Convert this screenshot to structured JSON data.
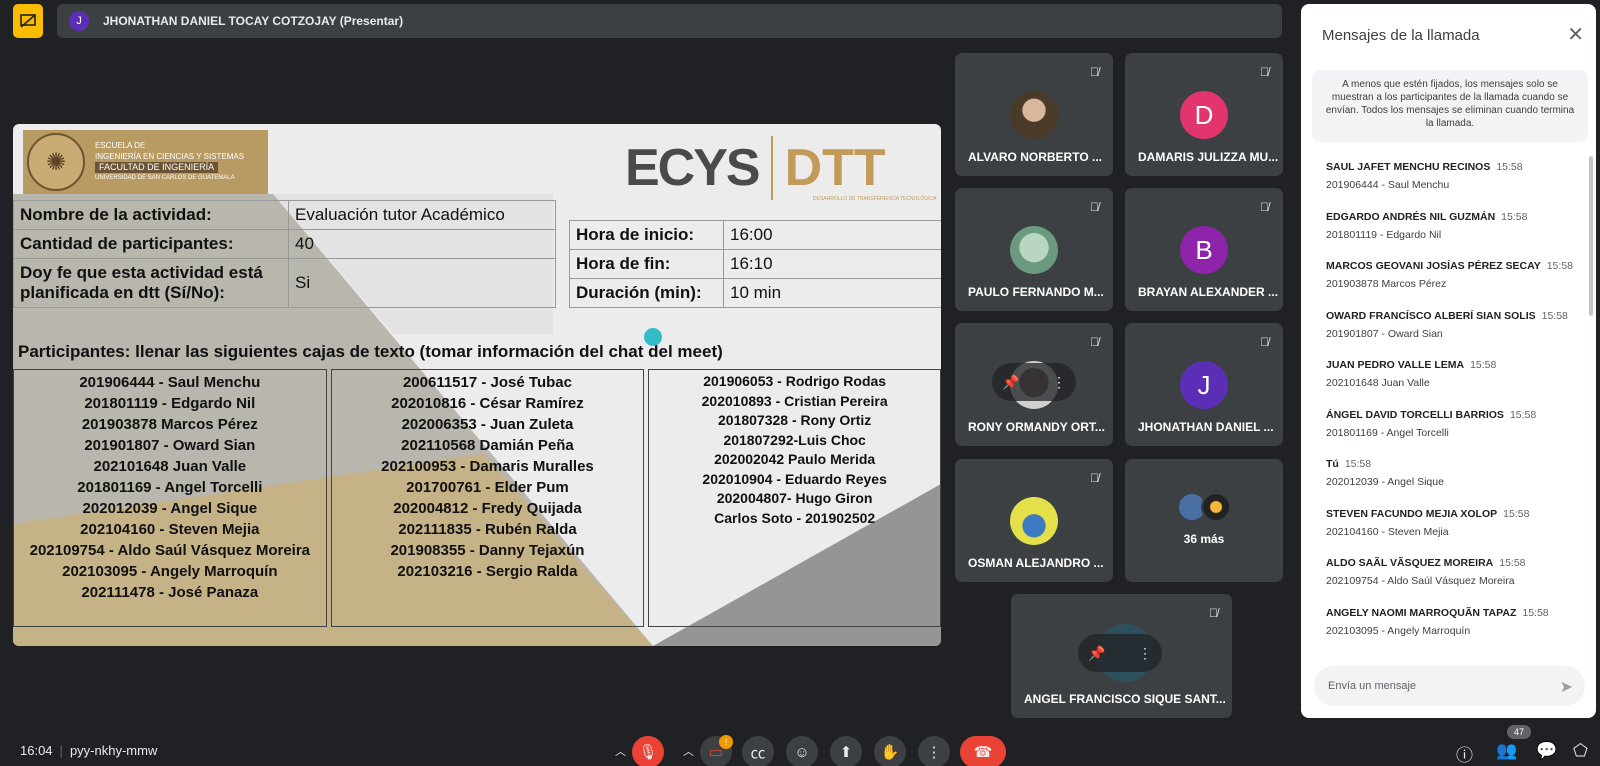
{
  "presenter": {
    "avatar_letter": "J",
    "name": "JHONATHAN DANIEL TOCAY COTZOJAY (Presentar)"
  },
  "slide": {
    "logo": {
      "line1": "ESCUELA DE",
      "line2": "INGENIERÍA EN CIENCIAS Y SISTEMAS",
      "faculty": "FACULTAD DE INGENIERÍA",
      "university": "UNIVERSIDAD DE SAN CARLOS DE GUATEMALA"
    },
    "brand_left": "ECYS",
    "brand_right": "DTT",
    "brand_sub": "DESARROLLO DE TRANSFERENCIA TECNOLÓGICA",
    "left_table": [
      {
        "label": "Nombre de la actividad:",
        "value": "Evaluación tutor Académico"
      },
      {
        "label": "Cantidad de participantes:",
        "value": "40"
      },
      {
        "label": "Doy fe que esta actividad está planificada en dtt (Sí/No):",
        "value": "Si"
      }
    ],
    "right_table": [
      {
        "label": "Hora de inicio:",
        "value": "16:00"
      },
      {
        "label": "Hora de fin:",
        "value": "16:10"
      },
      {
        "label": "Duración (min):",
        "value": "10 min"
      }
    ],
    "instruction": "Participantes: llenar las siguientes cajas de texto (tomar información del chat del meet)",
    "col1": [
      "201906444 - Saul Menchu",
      "201801119 - Edgardo Nil",
      "201903878 Marcos Pérez",
      "201901807 - Oward Sian",
      "202101648 Juan Valle",
      "201801169 - Angel Torcelli",
      "202012039 - Angel Sique",
      "202104160 - Steven Mejia",
      "202109754 - Aldo Saúl Vásquez Moreira",
      "202103095 - Angely Marroquín",
      "202111478 - José Panaza"
    ],
    "col2": [
      "200611517 - José Tubac",
      "202010816 - César Ramírez",
      "202006353 - Juan Zuleta",
      "202110568 Damián Peña",
      "202100953 - Damaris Muralles",
      "201700761 - Elder Pum",
      "202004812 - Fredy Quijada",
      "202111835 - Rubén Ralda",
      "201908355 - Danny Tejaxún",
      "202103216 - Sergio Ralda"
    ],
    "col3": [
      "201906053 - Rodrigo Rodas",
      "202010893 - Cristian Pereira",
      "201807328 - Rony Ortiz",
      "201807292-Luis Choc",
      "202002042 Paulo Merida",
      "202010904 - Eduardo Reyes",
      "202004807- Hugo Giron",
      "Carlos Soto - 201902502"
    ]
  },
  "tiles": [
    {
      "name": "ALVARO NORBERTO ...",
      "avatar": "",
      "photo": "ph"
    },
    {
      "name": "DAMARIS JULIZZA MU...",
      "avatar": "D",
      "color": "#e2356e"
    },
    {
      "name": "PAULO FERNANDO M...",
      "avatar": "",
      "photo": "ph2"
    },
    {
      "name": "BRAYAN ALEXANDER ...",
      "avatar": "B",
      "color": "#8e24aa"
    },
    {
      "name": "RONY ORMANDY ORT...",
      "avatar": "",
      "photo": "ph3"
    },
    {
      "name": "JHONATHAN DANIEL ...",
      "avatar": "J",
      "color": "#5b2fb5"
    },
    {
      "name": "OSMAN ALEJANDRO ...",
      "avatar": "",
      "photo": "ph4"
    },
    {
      "name": "36 más",
      "avatar": ""
    },
    {
      "name": "ANGEL FRANCISCO SIQUE SANT..."
    }
  ],
  "chat": {
    "title": "Mensajes de la llamada",
    "note": "A menos que estén fijados, los mensajes solo se muestran a los participantes de la llamada cuando se envían. Todos los mensajes se eliminan cuando termina la llamada.",
    "messages": [
      {
        "who": "SAUL JAFET MENCHU RECINOS",
        "time": "15:58",
        "text": "201906444 - Saul Menchu"
      },
      {
        "who": "EDGARDO ANDRÉS NIL GUZMÁN",
        "time": "15:58",
        "text": "201801119 - Edgardo Nil"
      },
      {
        "who": "MARCOS GEOVANI JOSÍAS PÉREZ SECAY",
        "time": "15:58",
        "text": "201903878 Marcos Pérez"
      },
      {
        "who": "OWARD FRANCÍSCO ALBERÍ SIAN SOLIS",
        "time": "15:58",
        "text": "201901807 - Oward Sian"
      },
      {
        "who": "JUAN PEDRO VALLE LEMA",
        "time": "15:58",
        "text": "202101648 Juan Valle"
      },
      {
        "who": "ÁNGEL DAVID TORCELLI BARRIOS",
        "time": "15:58",
        "text": "201801169 - Angel Torcelli"
      },
      {
        "who": "Tú",
        "time": "15:58",
        "text": "202012039 - Angel Sique"
      },
      {
        "who": "STEVEN FACUNDO MEJIA XOLOP",
        "time": "15:58",
        "text": "202104160 - Steven Mejia"
      },
      {
        "who": "ALDO SAÃL VÃSQUEZ MOREIRA",
        "time": "15:58",
        "text": "202109754 - Aldo Saúl Vásquez Moreira"
      },
      {
        "who": "ANGELY NAOMI MARROQUÃN TAPAZ",
        "time": "15:58",
        "text": "202103095 - Angely Marroquín"
      }
    ],
    "input_placeholder": "Envía un mensaje"
  },
  "bottom": {
    "time": "16:04",
    "meeting_code": "pyy-nkhy-mmw",
    "camera_badge": "!",
    "participants_count": "47"
  }
}
